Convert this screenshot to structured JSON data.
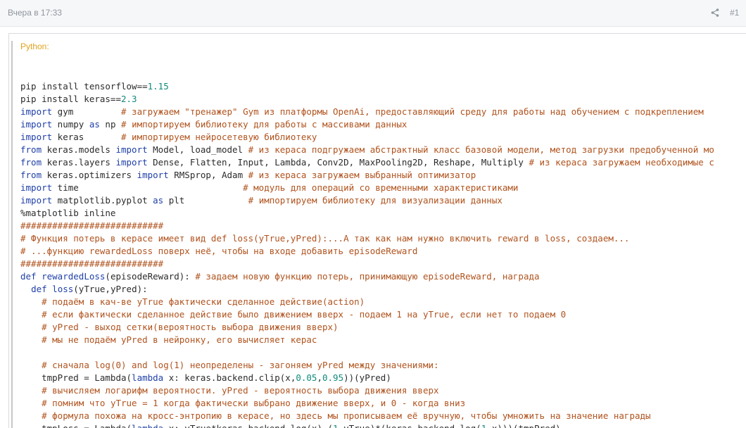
{
  "post": {
    "date": "Вчера в 17:33",
    "number": "#1",
    "share_icon": "share-icon"
  },
  "code_block": {
    "language_label": "Python:",
    "lines": [
      [],
      [
        [
          "tx",
          "pip install tensorflow=="
        ],
        [
          "num",
          "1.15"
        ]
      ],
      [
        [
          "tx",
          "pip install keras=="
        ],
        [
          "num",
          "2.3"
        ]
      ],
      [
        [
          "kw",
          "import"
        ],
        [
          "tx",
          " gym         "
        ],
        [
          "cm",
          "# загружаем \"тренажер\" Gym из платформы OpenAi, предоставляющий среду для работы над обучением с подкреплением"
        ]
      ],
      [
        [
          "kw",
          "import"
        ],
        [
          "tx",
          " numpy "
        ],
        [
          "kw",
          "as"
        ],
        [
          "tx",
          " np "
        ],
        [
          "cm",
          "# импортируем библиотеку для работы с массивами данных"
        ]
      ],
      [
        [
          "kw",
          "import"
        ],
        [
          "tx",
          " keras       "
        ],
        [
          "cm",
          "# импортируем нейросетевую библиотеку"
        ]
      ],
      [
        [
          "kw",
          "from"
        ],
        [
          "tx",
          " keras.models "
        ],
        [
          "kw",
          "import"
        ],
        [
          "tx",
          " Model, load_model "
        ],
        [
          "cm",
          "# из кераса подгружаем абстрактный класс базовой модели, метод загрузки предобученной мо"
        ]
      ],
      [
        [
          "kw",
          "from"
        ],
        [
          "tx",
          " keras.layers "
        ],
        [
          "kw",
          "import"
        ],
        [
          "tx",
          " Dense, Flatten, Input, Lambda, Conv2D, MaxPooling2D, Reshape, Multiply "
        ],
        [
          "cm",
          "# из кераса загружаем необходимые с"
        ]
      ],
      [
        [
          "kw",
          "from"
        ],
        [
          "tx",
          " keras.optimizers "
        ],
        [
          "kw",
          "import"
        ],
        [
          "tx",
          " RMSprop, Adam "
        ],
        [
          "cm",
          "# из кераса загружаем выбранный оптимизатор"
        ]
      ],
      [
        [
          "kw",
          "import"
        ],
        [
          "tx",
          " time                               "
        ],
        [
          "cm",
          "# модуль для операций со временными характеристиками"
        ]
      ],
      [
        [
          "kw",
          "import"
        ],
        [
          "tx",
          " matplotlib.pyplot "
        ],
        [
          "kw",
          "as"
        ],
        [
          "tx",
          " plt            "
        ],
        [
          "cm",
          "# импортируем библиотеку для визуализации данных"
        ]
      ],
      [
        [
          "tx",
          "%matplotlib inline"
        ]
      ],
      [
        [
          "cm",
          "###########################"
        ]
      ],
      [
        [
          "cm",
          "# Функция потерь в керасе имеет вид def loss(yTrue,yPred):...А так как нам нужно включить reward в loss, создаем..."
        ]
      ],
      [
        [
          "cm",
          "# ...функцию rewardedLoss поверх неё, чтобы на входе добавить episodeReward"
        ]
      ],
      [
        [
          "cm",
          "###########################"
        ]
      ],
      [
        [
          "kw",
          "def"
        ],
        [
          "tx",
          " "
        ],
        [
          "fn",
          "rewardedLoss"
        ],
        [
          "tx",
          "(episodeReward): "
        ],
        [
          "cm",
          "# задаем новую функцию потерь, принимающую episodeReward, награда"
        ]
      ],
      [
        [
          "tx",
          "  "
        ],
        [
          "kw",
          "def"
        ],
        [
          "tx",
          " "
        ],
        [
          "fn",
          "loss"
        ],
        [
          "tx",
          "(yTrue,yPred):"
        ]
      ],
      [
        [
          "tx",
          "    "
        ],
        [
          "cm",
          "# подаём в кач-ве yTrue фактически сделанное действие(action)"
        ]
      ],
      [
        [
          "tx",
          "    "
        ],
        [
          "cm",
          "# если фактически сделанное действие было движением вверх - подаем 1 на yTrue, если нет то подаем 0"
        ]
      ],
      [
        [
          "tx",
          "    "
        ],
        [
          "cm",
          "# yPred - выход сетки(вероятность выбора движения вверх)"
        ]
      ],
      [
        [
          "tx",
          "    "
        ],
        [
          "cm",
          "# мы не подаём yPred в нейронку, его вычисляет керас"
        ]
      ],
      [],
      [
        [
          "tx",
          "    "
        ],
        [
          "cm",
          "# сначала log(0) and log(1) неопределены - загоняем yPred между значениями:"
        ]
      ],
      [
        [
          "tx",
          "    tmpPred = Lambda("
        ],
        [
          "kw",
          "lambda"
        ],
        [
          "tx",
          " x: keras.backend.clip(x,"
        ],
        [
          "num",
          "0.05"
        ],
        [
          "tx",
          ","
        ],
        [
          "num",
          "0.95"
        ],
        [
          "tx",
          "))(yPred)"
        ]
      ],
      [
        [
          "tx",
          "    "
        ],
        [
          "cm",
          "# вычисляем логарифм вероятности. yPred - вероятность выбора движения вверх"
        ]
      ],
      [
        [
          "tx",
          "    "
        ],
        [
          "cm",
          "# помним что yTrue = 1 когда фактически выбрано движение вверх, и 0 - когда вниз"
        ]
      ],
      [
        [
          "tx",
          "    "
        ],
        [
          "cm",
          "# формула похожа на кросс-энтропию в керасе, но здесь мы прописываем её вручную, чтобы умножить на значение награды"
        ]
      ],
      [
        [
          "tx",
          "    tmpLoss = Lambda("
        ],
        [
          "kw",
          "lambda"
        ],
        [
          "tx",
          " x:-yTrue*keras.backend.log(x)-("
        ],
        [
          "num",
          "1"
        ],
        [
          "tx",
          "-yTrue)*(keras.backend.log("
        ],
        [
          "num",
          "1"
        ],
        [
          "tx",
          "-x)))(tmpPred)"
        ]
      ]
    ]
  }
}
